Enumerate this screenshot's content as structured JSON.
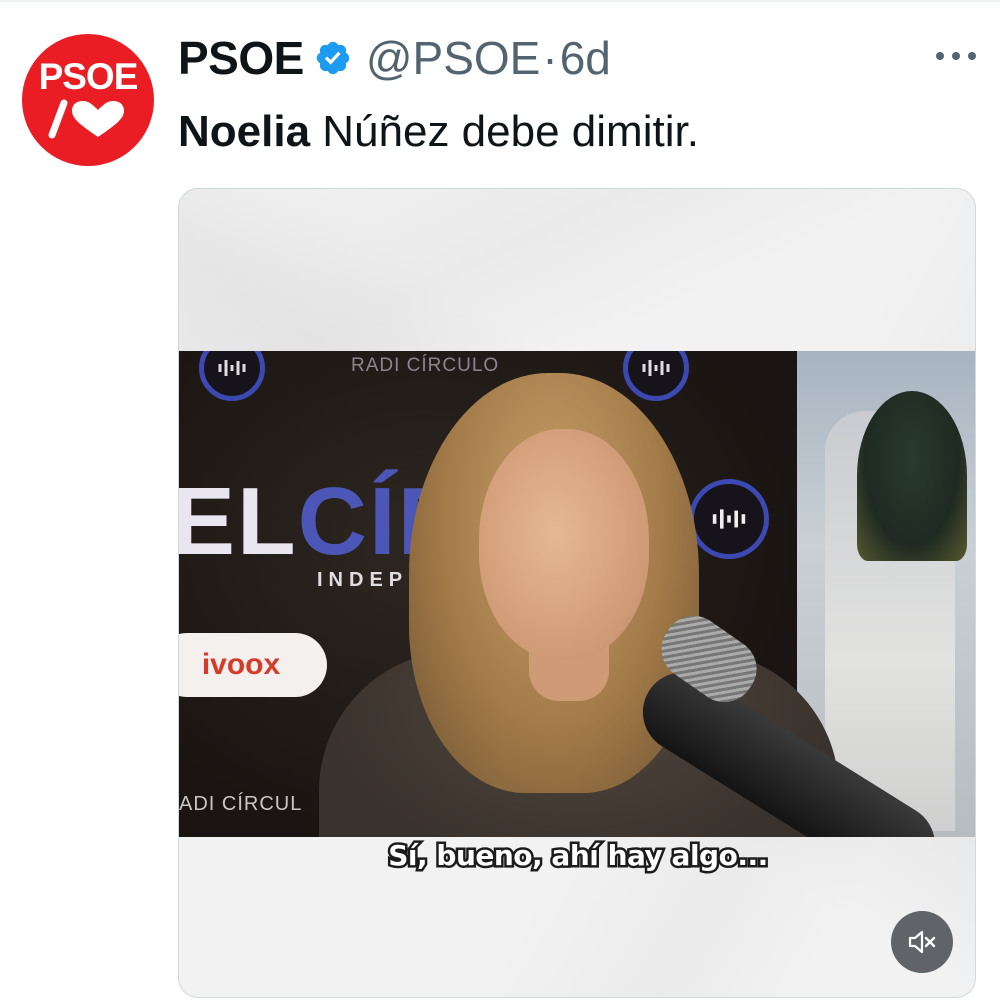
{
  "author": {
    "avatar_text": "PSOE",
    "display_name": "PSOE",
    "handle": "@PSOE",
    "separator": "·",
    "time": "6d",
    "verified": true
  },
  "tweet": {
    "text_bold": "Noelia",
    "text_rest": " Núñez debe dimitir."
  },
  "media": {
    "signage": {
      "radio_top": "RADI   CÍRCULO",
      "elcirculo_white": "EL",
      "elcirculo_blue": "CÍR",
      "indep": "INDEP",
      "ivoox": "ivoox",
      "radio_bottom": "ADI   CÍRCUL"
    },
    "caption": "Sí, bueno, ahí hay algo...",
    "mute_icon": "speaker-muted-icon"
  },
  "icons": {
    "more": "more-horizontal-icon",
    "verified": "verified-badge-icon",
    "heart": "heart-icon"
  },
  "colors": {
    "brand_red": "#ea1d24",
    "verified_blue": "#1d9bf0",
    "secondary_text": "#536471"
  }
}
